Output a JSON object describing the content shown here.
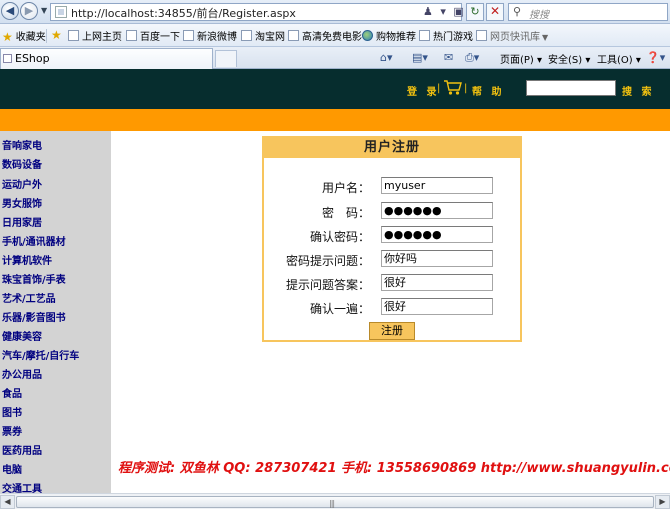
{
  "browser": {
    "url": "http://localhost:34855/前台/Register.aspx",
    "search_placeholder": "搜搜",
    "favorites_label": "收藏夹",
    "favorites": [
      "上网主页",
      "百度一下",
      "新浪微博",
      "淘宝网",
      "高清免费电影",
      "购物推荐",
      "热门游戏",
      "网页快讯库"
    ],
    "tab_title": "EShop",
    "commands": {
      "page": "页面(P)",
      "safety": "安全(S)",
      "tools": "工具(O)"
    }
  },
  "header": {
    "login": "登 录",
    "help": "帮 助",
    "sep": "|",
    "search_value": "",
    "search_button": "搜 索"
  },
  "categories": [
    "音响家电",
    "数码设备",
    "运动户外",
    "男女服饰",
    "日用家居",
    "手机/通讯器材",
    "计算机软件",
    "珠宝首饰/手表",
    "艺术/工艺品",
    "乐器/影音图书",
    "健康美容",
    "汽车/摩托/自行车",
    "办公用品",
    "食品",
    "图书",
    "票券",
    "医药用品",
    "电脑",
    "交通工具"
  ],
  "form": {
    "title": "用户注册",
    "fields": [
      {
        "label": "用户名：",
        "value": "myuser"
      },
      {
        "label": "密　码：",
        "value": "●●●●●●"
      },
      {
        "label": "确认密码：",
        "value": "●●●●●●"
      },
      {
        "label": "密码提示问题：",
        "value": "你好吗"
      },
      {
        "label": "提示问题答案：",
        "value": "很好"
      },
      {
        "label": "确认一遍：",
        "value": "很好"
      }
    ],
    "submit_label": "注册"
  },
  "footer_note": "程序测试: 双鱼林   QQ: 287307421   手机: 13558690869   http://www.shuangyulin.com",
  "colors": {
    "header_bg": "#062d2e",
    "accent_orange": "#ff9900",
    "form_gold": "#f7c55d",
    "category_text": "#000080",
    "footer_red": "#e01010"
  }
}
